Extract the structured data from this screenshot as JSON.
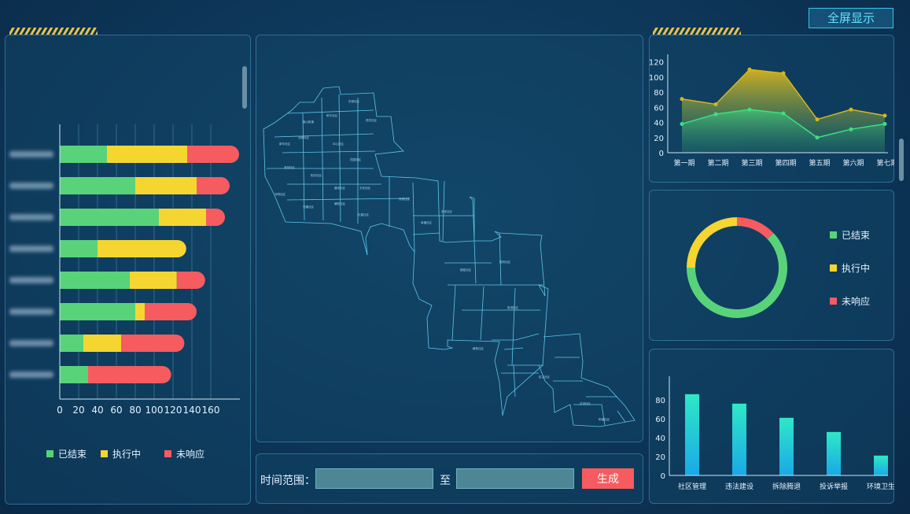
{
  "header": {
    "fullscreen_label": "全屏显示"
  },
  "colors": {
    "done": "#59d37a",
    "inprogress": "#f5d631",
    "noresponse": "#f55b5f",
    "accent": "#3cc3e6"
  },
  "left_chart": {
    "legend": [
      "已结束",
      "执行中",
      "未响应"
    ],
    "category_labels_blurred": true,
    "chart_data": {
      "type": "bar",
      "orientation": "horizontal",
      "stacked": true,
      "xlim": [
        0,
        185
      ],
      "xticks": [
        "0",
        "20",
        "40",
        "60",
        "80",
        "100",
        "120",
        "140",
        "160"
      ],
      "series": [
        {
          "name": "已结束",
          "values": [
            50,
            80,
            105,
            40,
            74,
            80,
            25,
            30
          ]
        },
        {
          "name": "执行中",
          "values": [
            85,
            65,
            50,
            94,
            50,
            10,
            40,
            0
          ]
        },
        {
          "name": "未响应",
          "values": [
            55,
            35,
            20,
            0,
            30,
            55,
            67,
            88
          ]
        }
      ]
    }
  },
  "map": {
    "district_labels": [
      "南山街道",
      "和平社区",
      "东城社区",
      "西关社区",
      "新华社区",
      "北苑社区",
      "中心社区",
      "花园社区",
      "滨河社区",
      "阳光社区",
      "建设社区",
      "文化社区",
      "光明社区",
      "兴隆社区",
      "朝阳社区",
      "红星社区",
      "长安社区",
      "幸福社区",
      "永安社区",
      "团结社区",
      "胜利社区",
      "前进社区",
      "解放社区",
      "民主社区",
      "友谊社区",
      "和谐社区"
    ]
  },
  "time_range": {
    "label": "时间范围：",
    "separator": "至",
    "start_value": "",
    "end_value": "",
    "generate_label": "生成"
  },
  "line_chart": {
    "chart_data": {
      "type": "area",
      "categories": [
        "第一期",
        "第二期",
        "第三期",
        "第四期",
        "第五期",
        "第六期",
        "第七期"
      ],
      "ylim": [
        0,
        130
      ],
      "yticks": [
        "0",
        "20",
        "40",
        "60",
        "80",
        "100",
        "120"
      ],
      "series": [
        {
          "values": [
            71,
            64,
            110,
            105,
            44,
            57,
            49
          ],
          "color": "#d9b51c"
        },
        {
          "values": [
            38,
            51,
            57,
            52,
            20,
            31,
            38
          ],
          "color": "#3ddf84"
        }
      ]
    }
  },
  "donut": {
    "legend": [
      "已结束",
      "执行中",
      "未响应"
    ],
    "chart_data": {
      "type": "pie",
      "labels": [
        "已结束",
        "执行中",
        "未响应"
      ],
      "values": [
        62,
        25,
        13
      ]
    }
  },
  "bottom_bar": {
    "chart_data": {
      "type": "bar",
      "categories": [
        "社区管理",
        "违法建设",
        "拆除腾退",
        "投诉举报",
        "环境卫生"
      ],
      "values": [
        86,
        76,
        61,
        46,
        21
      ],
      "ylim": [
        0,
        105
      ],
      "yticks": [
        "0",
        "20",
        "40",
        "60",
        "80"
      ]
    }
  }
}
